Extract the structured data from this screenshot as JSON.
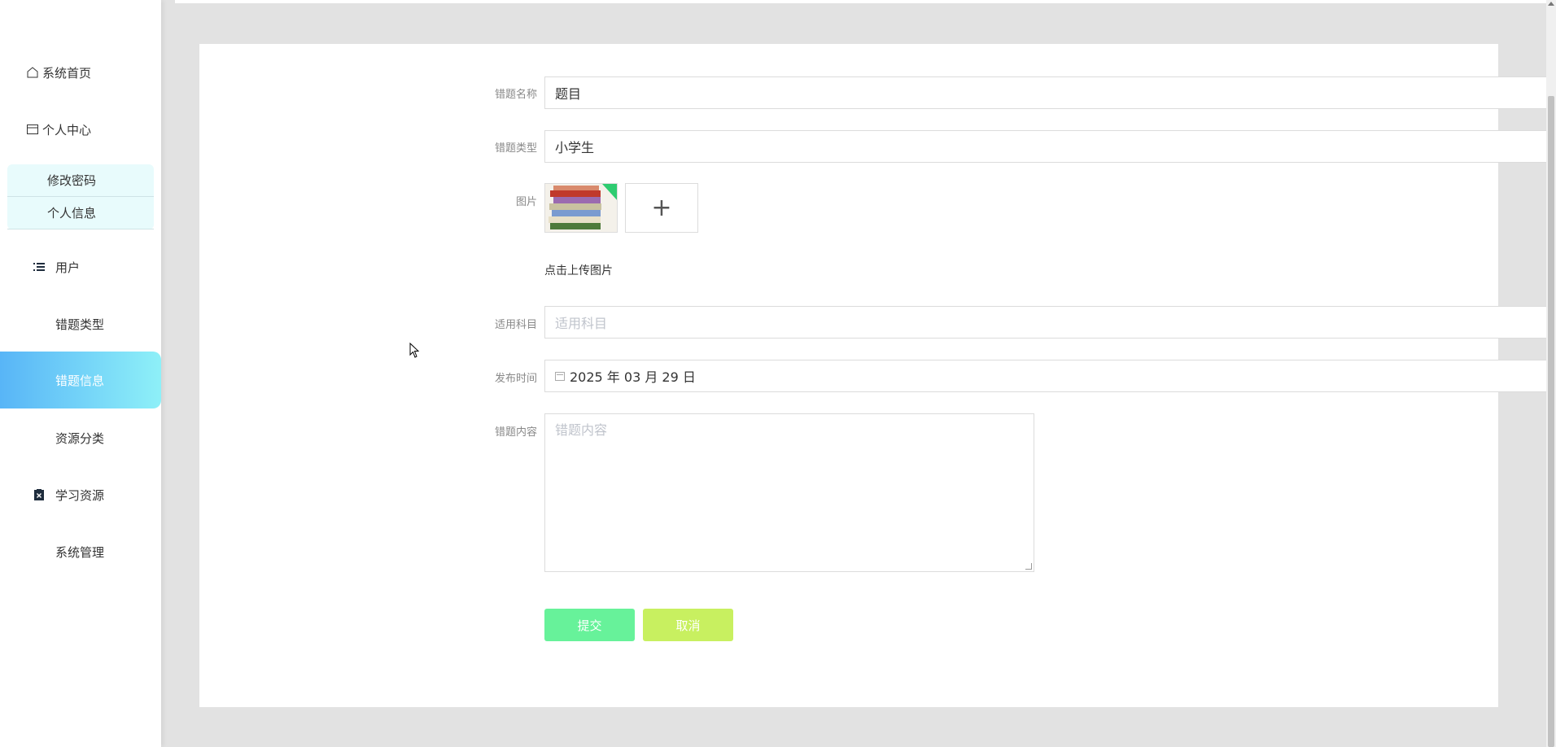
{
  "sidebar": {
    "home": "系统首页",
    "profile": "个人中心",
    "profile_sub": [
      "修改密码",
      "个人信息"
    ],
    "menu": [
      {
        "label": "用户",
        "icon": "list-icon"
      },
      {
        "label": "错题类型",
        "icon": "grid-icon"
      },
      {
        "label": "错题信息",
        "icon": "grid-icon",
        "active": true
      },
      {
        "label": "资源分类",
        "icon": "grid-icon"
      },
      {
        "label": "学习资源",
        "icon": "clipboard-x-icon"
      },
      {
        "label": "系统管理",
        "icon": "grid-icon"
      }
    ]
  },
  "form": {
    "name_label": "错题名称",
    "name_value": "题目",
    "type_label": "错题类型",
    "type_value": "小学生",
    "image_label": "图片",
    "upload_tip": "点击上传图片",
    "add_symbol": "+",
    "subject_label": "适用科目",
    "subject_placeholder": "适用科目",
    "date_label": "发布时间",
    "date_value": "2025 年 03 月 29 日",
    "content_label": "错题内容",
    "content_placeholder": "错题内容",
    "submit": "提交",
    "cancel": "取消"
  },
  "colors": {
    "active_gradient_start": "#58b5f7",
    "active_gradient_end": "#8ef0f8",
    "submit_bg": "#67f29a",
    "cancel_bg": "#c8f060"
  }
}
